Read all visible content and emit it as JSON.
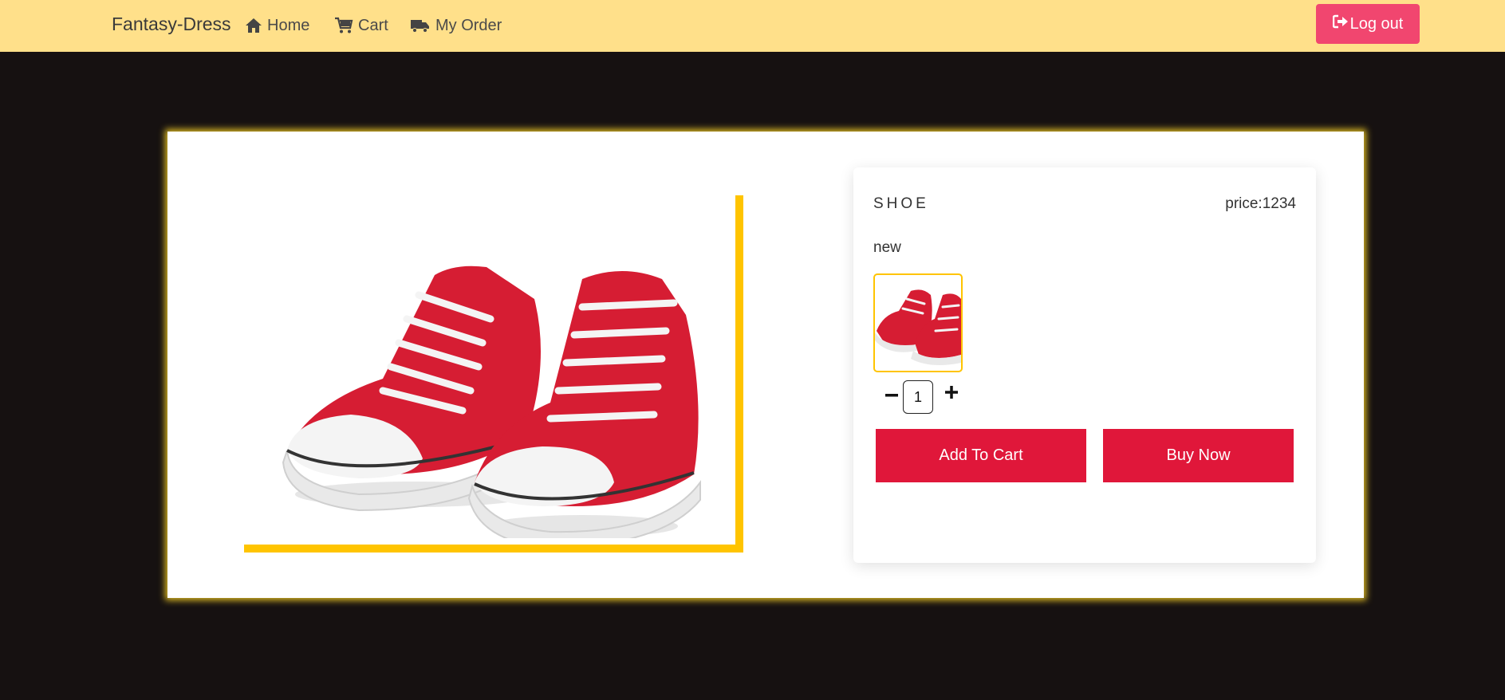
{
  "nav": {
    "brand": "Fantasy-Dress",
    "home_label": "Home",
    "cart_label": "Cart",
    "order_label": "My Order",
    "logout_label": "Log out"
  },
  "product": {
    "name": "SHOE",
    "price_label": "price:",
    "price_value": "1234",
    "condition": "new",
    "quantity": "1",
    "add_to_cart_label": "Add To Cart",
    "buy_now_label": "Buy Now"
  },
  "colors": {
    "navbar": "#ffe08a",
    "page_background": "#161111",
    "logout": "#f1466f",
    "action_buttons": "#e0173a",
    "accent": "#ffc400",
    "shoe": "#d61d33"
  },
  "icons": {
    "home": "home-icon",
    "cart": "cart-icon",
    "order": "truck-icon",
    "logout": "sign-out-icon",
    "minus": "minus-icon",
    "plus": "plus-icon"
  }
}
